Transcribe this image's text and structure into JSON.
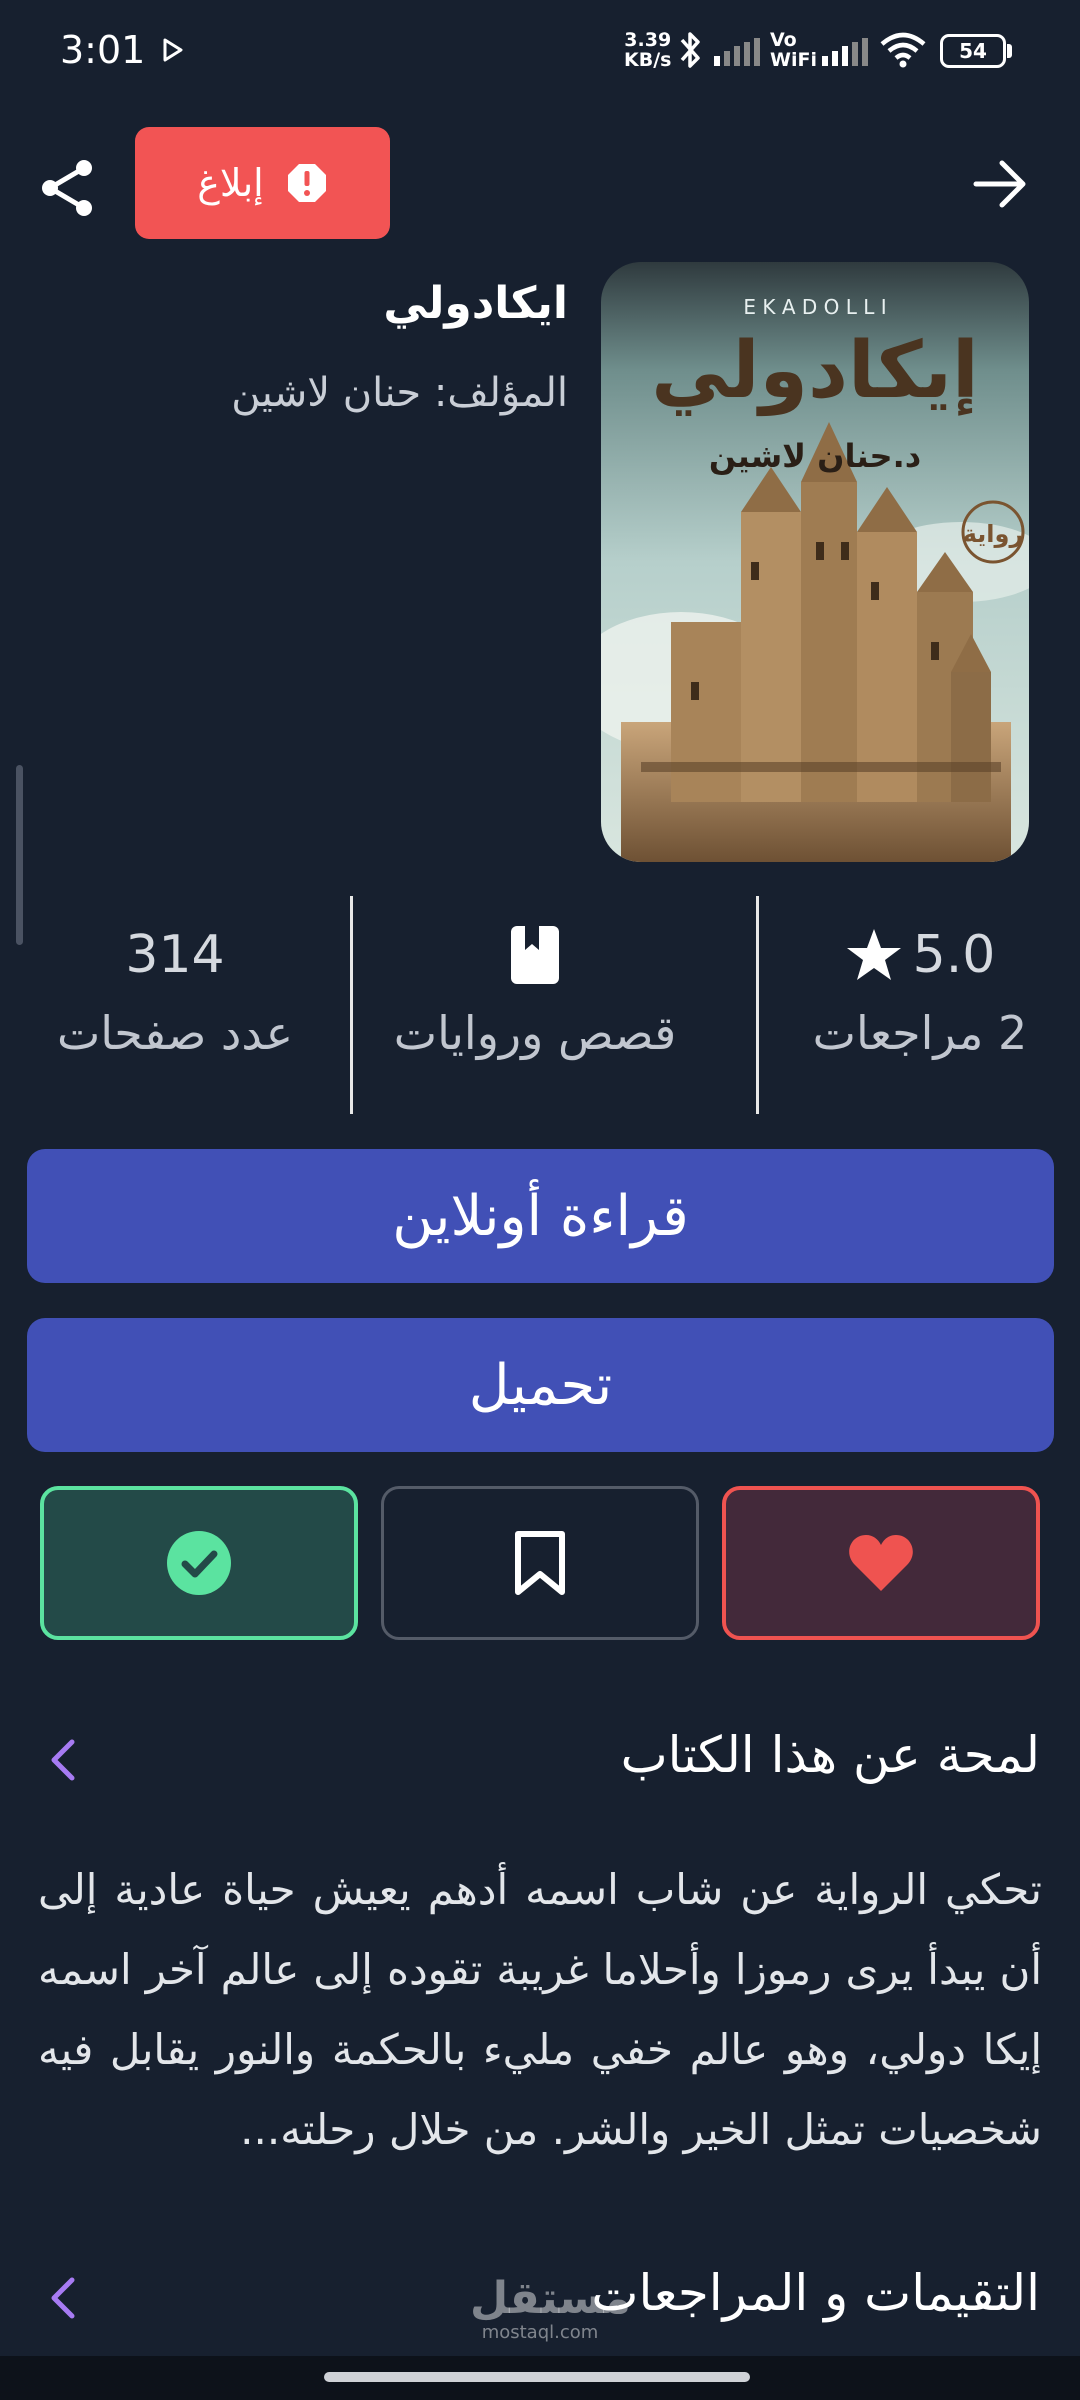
{
  "status_bar": {
    "time": "3:01",
    "speed_value": "3.39",
    "speed_unit": "KB/s",
    "vo": "Vo",
    "wifi_label": "WiFi",
    "battery": "54"
  },
  "header": {
    "report_label": "إبلاغ"
  },
  "book": {
    "title": "ايكادولي",
    "author": "المؤلف: حنان لاشين",
    "cover": {
      "latin_title": "E K A D O L L I",
      "arabic_title": "إيكادولي",
      "author": "د.حنان لاشين",
      "badge": "رواية"
    }
  },
  "stats": {
    "rating": "5.0",
    "reviews": "2 مراجعات",
    "category": "قصص وروايات",
    "pages": "314",
    "pages_label": "عدد صفحات"
  },
  "actions": {
    "read_online": "قراءة أونلاين",
    "download": "تحميل"
  },
  "about": {
    "title": "لمحة عن هذا الكتاب",
    "text": "تحكي الرواية عن شاب اسمه أدهم يعيش حياة عادية إلى أن يبدأ يرى رموزا وأحلاما غريبة تقوده إلى عالم آخر اسمه إيكا دولي، وهو عالم خفي مليء بالحكمة والنور يقابل فيه شخصيات تمثل الخير والشر. من خلال رحلته..."
  },
  "reviews_section": {
    "title": "التقيمات و المراجعات"
  },
  "watermark": {
    "arabic": "مستقل",
    "latin": "mostaql.com"
  },
  "colors": {
    "background": "#17202f",
    "report": "#f25454",
    "primary_button": "#4150b6",
    "favorite": "#ef5350",
    "done": "#5be3a0",
    "chevron": "#a77bf3"
  }
}
